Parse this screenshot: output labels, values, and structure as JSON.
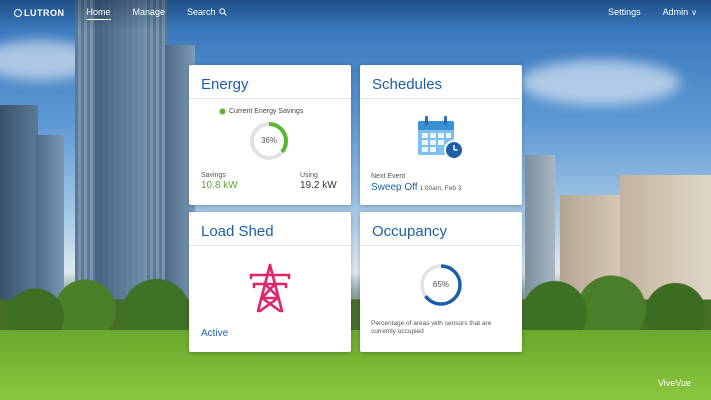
{
  "nav": {
    "logo": "LUTRON",
    "links": [
      "Home",
      "Manage",
      "Search"
    ],
    "settings": "Settings",
    "user": "Admin"
  },
  "cards": {
    "energy": {
      "title": "Energy",
      "legend": "Current Energy Savings",
      "percent_text": "36%",
      "percent": 36,
      "savings_label": "Savings",
      "savings_value": "10.8 kW",
      "using_label": "Using",
      "using_value": "19.2 kW"
    },
    "schedules": {
      "title": "Schedules",
      "next_label": "Next Event",
      "next_name": "Sweep Off",
      "next_time": "1:00am, Feb 3"
    },
    "load_shed": {
      "title": "Load Shed",
      "status": "Active"
    },
    "occupancy": {
      "title": "Occupancy",
      "percent_text": "65%",
      "percent": 65,
      "description": "Percentage of areas with sensors that are currently occupied"
    }
  },
  "brand": "ViveVue",
  "colors": {
    "accent_blue": "#1c5fa8",
    "green": "#5aa52e",
    "pink": "#e0256f",
    "calendar_blue": "#4aa3e0"
  }
}
